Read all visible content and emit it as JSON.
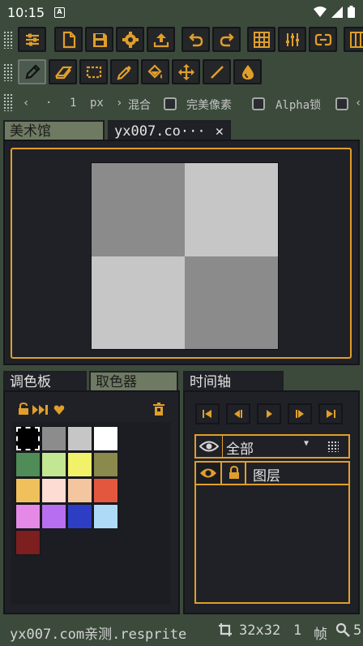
{
  "status": {
    "time": "10:15",
    "notif_badge": "A"
  },
  "options": {
    "brush_size": "1",
    "unit": "px",
    "blend_label": "混合",
    "pixel_perfect_label": "完美像素",
    "alpha_lock_label": "Alpha锁"
  },
  "canvas_tabs": [
    {
      "label": "美术馆"
    },
    {
      "label": "yx007.co···"
    }
  ],
  "canvas": {
    "checker": [
      "#8b8b8b",
      "#c6c6c6",
      "#c6c6c6",
      "#8b8b8b"
    ]
  },
  "left_tabs": [
    {
      "label": "调色板"
    },
    {
      "label": "取色器"
    }
  ],
  "timeline_tab": {
    "label": "时间轴"
  },
  "palette": {
    "colors": [
      "#000000",
      "#8c8c8c",
      "#c6c6c6",
      "#ffffff",
      "#4f8c58",
      "#c3e693",
      "#f2f16a",
      "#8a8a4c",
      "#f0c05c",
      "#fddcd3",
      "#f4c6a0",
      "#e4573f",
      "#e48ae6",
      "#b86ef0",
      "#2e3ec4",
      "#aedaf8",
      "#7d1f1f"
    ]
  },
  "timeline": {
    "filter_value": "全部",
    "layer_name": "图层"
  },
  "bottom": {
    "filename": "yx007.com亲测.resprite",
    "canvas_size": "32x32",
    "frame_count": "1",
    "frame_unit": "帧",
    "zoom_partial": "5"
  },
  "accent_color": "#e09f2b"
}
